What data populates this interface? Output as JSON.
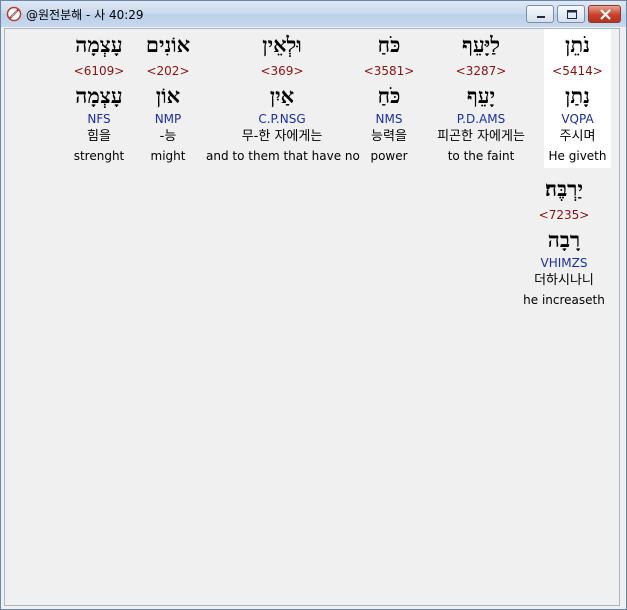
{
  "window": {
    "title": "@원전분해 - 사 40:29",
    "icon": "compass-app-icon",
    "controls": [
      "minimize",
      "maximize",
      "close"
    ]
  },
  "words": [
    {
      "surface": "נֹתֵן",
      "strong": "<5414>",
      "lemma": "נָתַן",
      "parse": "VQPA",
      "korean": "주시며",
      "english": "He giveth",
      "highlighted": true
    },
    {
      "surface": "לַיָּעֵף",
      "strong": "<3287>",
      "lemma": "יָעֵף",
      "parse": "P.D.AMS",
      "korean": "피곤한 자에게는",
      "english": "to the faint",
      "highlighted": false
    },
    {
      "surface": "כֹּחַ",
      "strong": "<3581>",
      "lemma": "כֹּחַ",
      "parse": "NMS",
      "korean": "능력을",
      "english": "power",
      "highlighted": false
    },
    {
      "surface": "וּלְאֵין",
      "strong": "<369>",
      "lemma": "אַיִן",
      "parse": "C.P.NSG",
      "korean": "무-한 자에게는",
      "english": "and to them that have no",
      "highlighted": false
    },
    {
      "surface": "אוֹנִים",
      "strong": "<202>",
      "lemma": "אוֹן",
      "parse": "NMP",
      "korean": "-능",
      "english": "might",
      "highlighted": false
    },
    {
      "surface": "עָצְמָה",
      "strong": "<6109>",
      "lemma": "עָצְמָה",
      "parse": "NFS",
      "korean": "힘을",
      "english": "strenght",
      "highlighted": false
    },
    {
      "surface": "יַרְבֶּה׃",
      "strong": "<7235>",
      "lemma": "רָבָה",
      "parse": "VHIMZS",
      "korean": "더하시나니",
      "english": "he increaseth",
      "highlighted": false
    }
  ]
}
